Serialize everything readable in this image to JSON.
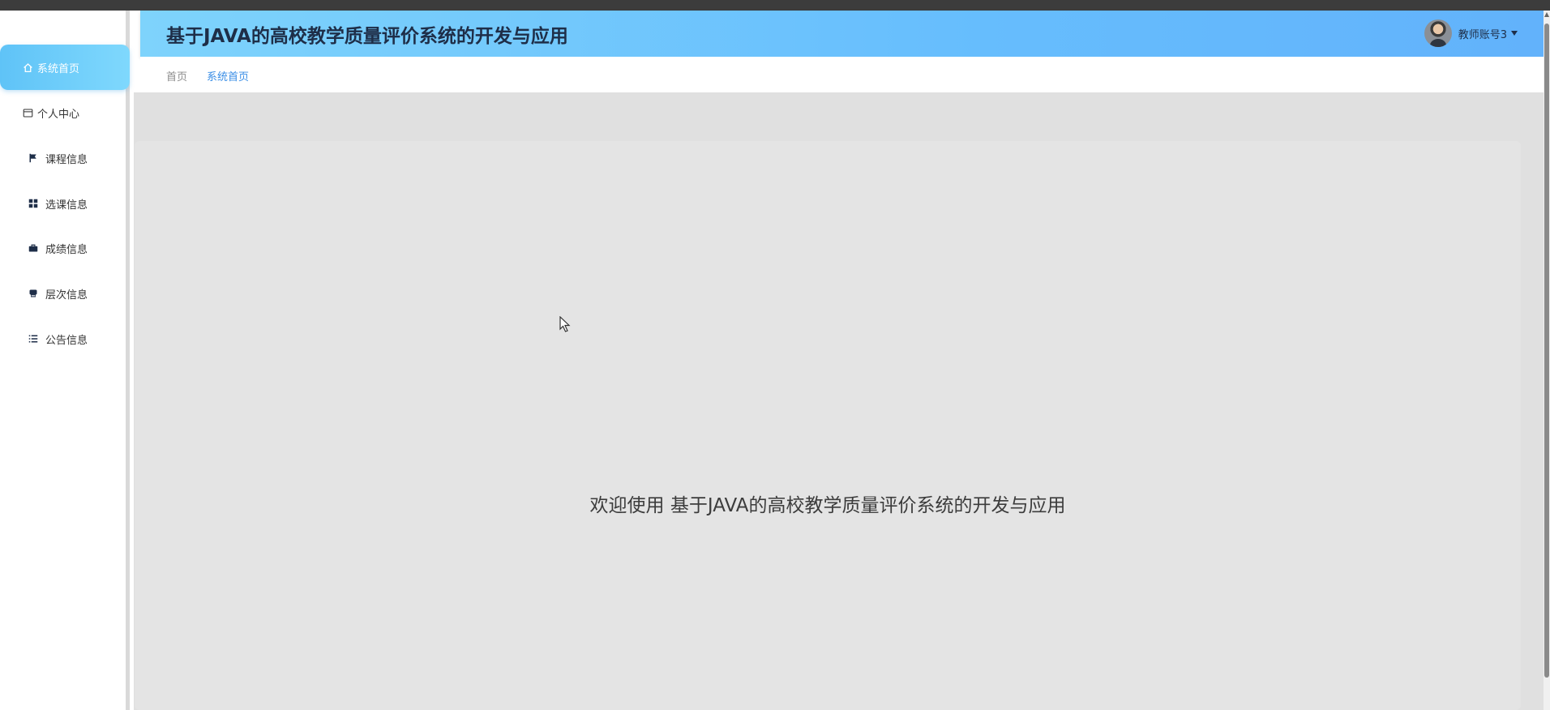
{
  "header": {
    "title": "基于JAVA的高校教学质量评价系统的开发与应用",
    "user_name": "教师账号3"
  },
  "sidebar": {
    "items": [
      {
        "label": "系统首页",
        "icon": "home-icon",
        "active": true
      },
      {
        "label": "个人中心",
        "icon": "card-icon",
        "active": false
      },
      {
        "label": "课程信息",
        "icon": "flag-icon",
        "active": false
      },
      {
        "label": "选课信息",
        "icon": "grid-icon",
        "active": false
      },
      {
        "label": "成绩信息",
        "icon": "briefcase-icon",
        "active": false
      },
      {
        "label": "层次信息",
        "icon": "print-icon",
        "active": false
      },
      {
        "label": "公告信息",
        "icon": "list-icon",
        "active": false
      }
    ]
  },
  "breadcrumb": {
    "home": "首页",
    "current": "系统首页"
  },
  "main": {
    "welcome_text": "欢迎使用 基于JAVA的高校教学质量评价系统的开发与应用"
  },
  "colors": {
    "header_gradient_start": "#7ed3fc",
    "header_gradient_end": "#62b2fb",
    "active_menu": "#6fcefa",
    "breadcrumb_active": "#3a8ee6",
    "title_text": "#1e2e48",
    "content_bg": "#e0e0e0"
  }
}
